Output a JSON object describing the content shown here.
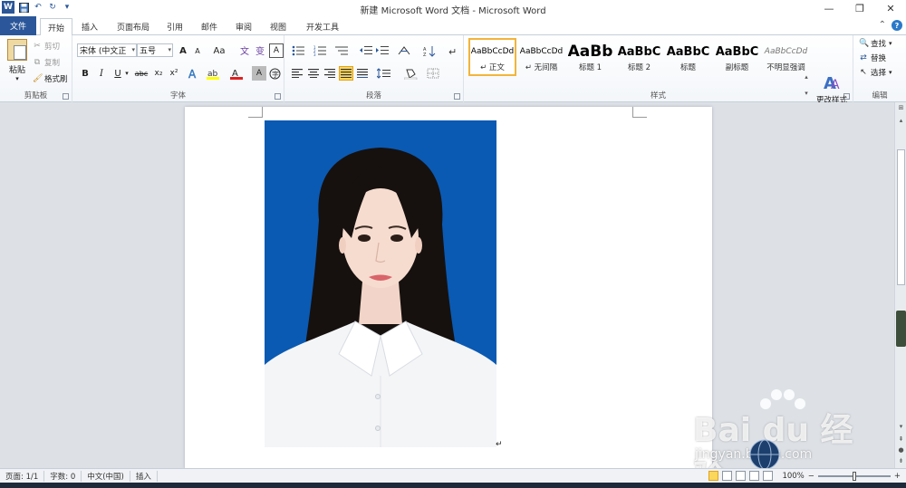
{
  "window": {
    "title": "新建 Microsoft Word 文档 - Microsoft Word",
    "minimize": "—",
    "restore": "❐",
    "close": "✕"
  },
  "qat": {
    "logo": "W",
    "save": "💾",
    "undo": "↶",
    "redo": "↻",
    "more": "▾"
  },
  "tabs": {
    "file": "文件",
    "items": [
      "开始",
      "插入",
      "页面布局",
      "引用",
      "邮件",
      "审阅",
      "视图",
      "开发工具"
    ],
    "active_index": 0,
    "collapse": "⌃",
    "help": "?"
  },
  "ribbon": {
    "clipboard": {
      "label": "剪贴板",
      "paste": "粘贴",
      "cut": "剪切",
      "copy": "复制",
      "format_painter": "格式刷"
    },
    "font": {
      "label": "字体",
      "font_name": "宋体 (中文正",
      "font_size": "五号",
      "grow": "A",
      "shrink": "A",
      "change_case": "Aa",
      "bold": "B",
      "italic": "I",
      "underline": "U",
      "strike": "abc",
      "subscript": "x₂",
      "superscript": "x²"
    },
    "paragraph": {
      "label": "段落"
    },
    "styles": {
      "label": "样式",
      "change_styles": "更改样式",
      "items": [
        {
          "sample": "AaBbCcDd",
          "name": "↵ 正文",
          "selected": true
        },
        {
          "sample": "AaBbCcDd",
          "name": "↵ 无间隔",
          "selected": false
        },
        {
          "sample": "AaBb",
          "name": "标题 1",
          "selected": false
        },
        {
          "sample": "AaBbC",
          "name": "标题 2",
          "selected": false
        },
        {
          "sample": "AaBbC",
          "name": "标题",
          "selected": false
        },
        {
          "sample": "AaBbC",
          "name": "副标题",
          "selected": false
        },
        {
          "sample": "AaBbCcDd",
          "name": "不明显强调",
          "selected": false
        }
      ]
    },
    "editing": {
      "label": "编辑",
      "find": "查找",
      "replace": "替换",
      "select": "选择"
    }
  },
  "statusbar": {
    "page": "页面: 1/1",
    "words": "字数: 0",
    "language": "中文(中国)",
    "mode": "插入",
    "zoom": "100%",
    "zoom_out": "−",
    "zoom_in": "+"
  },
  "watermark": {
    "brand": "Bai du 经验",
    "url": "jingyan.baidu.com"
  },
  "colors": {
    "accent": "#2b579a",
    "photo_bg": "#0a5ab3",
    "selected_style": "#f2b43b"
  }
}
